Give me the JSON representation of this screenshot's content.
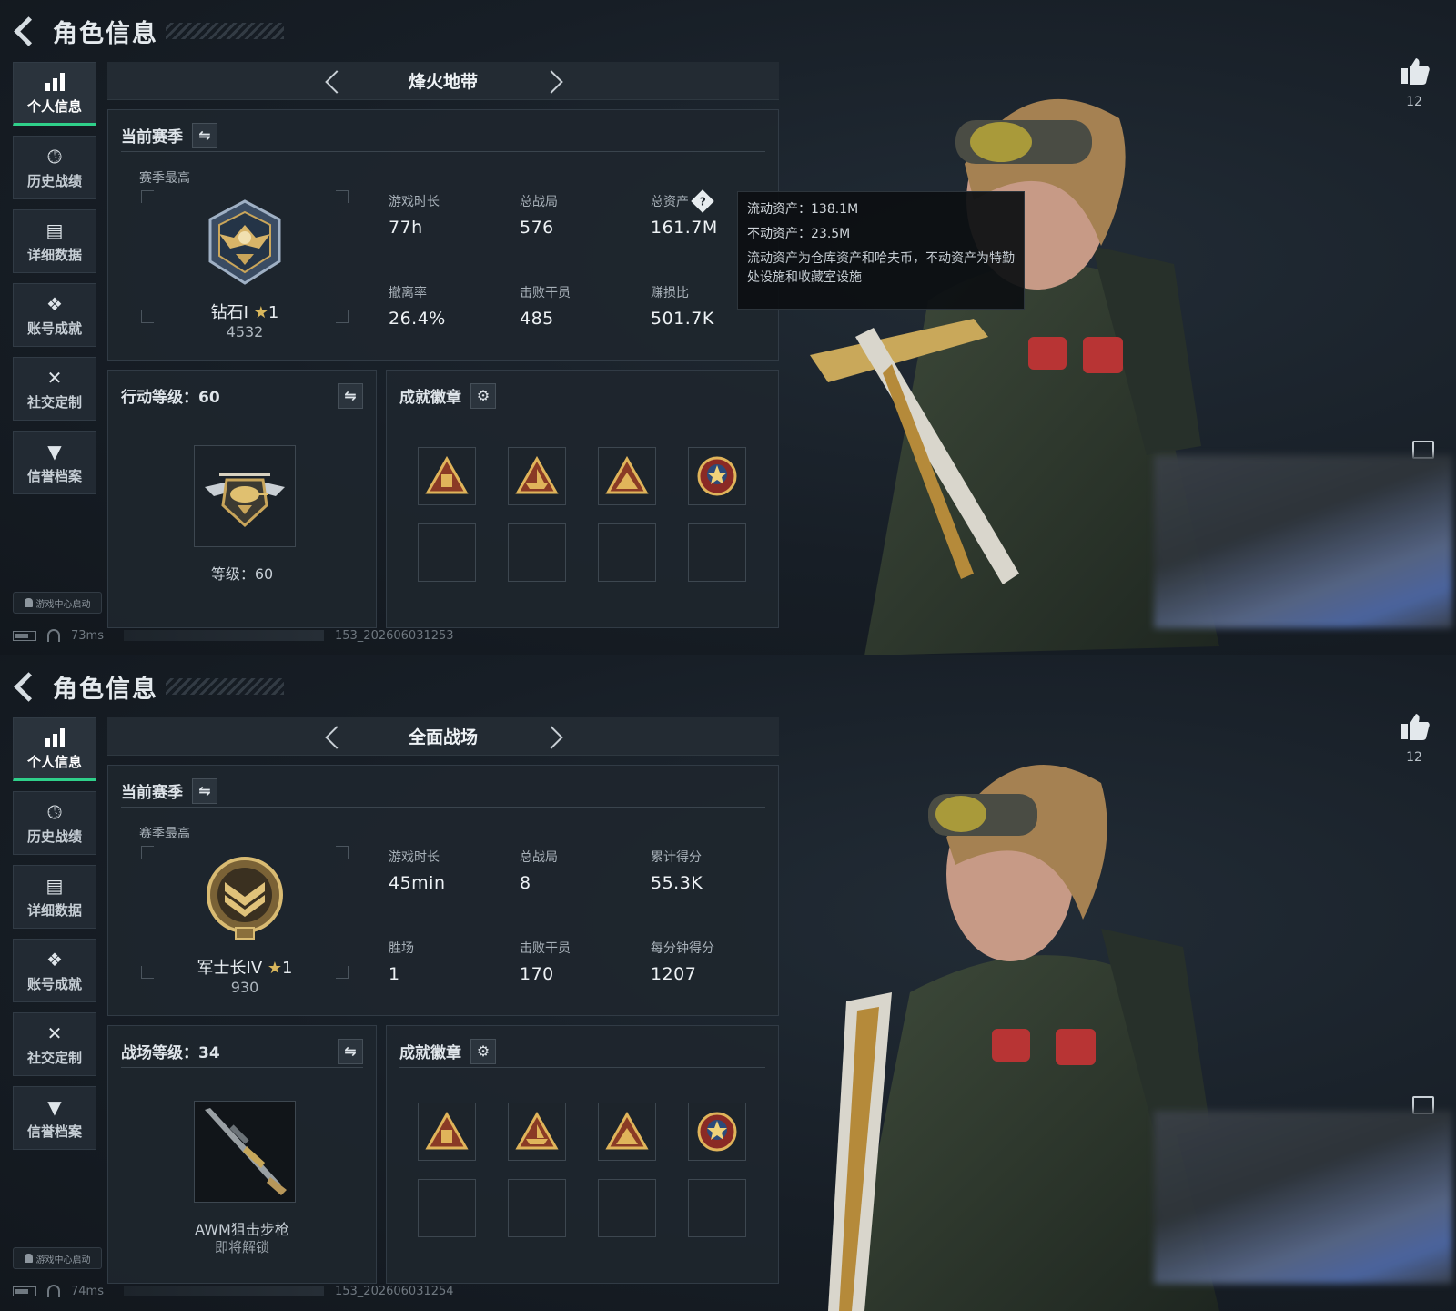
{
  "screens": [
    {
      "header": {
        "title": "角色信息"
      },
      "sidebar": [
        {
          "label": "个人信息",
          "icon": "bar-chart-icon",
          "active": true
        },
        {
          "label": "历史战绩",
          "icon": "clock-icon"
        },
        {
          "label": "详细数据",
          "icon": "folder-icon"
        },
        {
          "label": "账号成就",
          "icon": "achievement-icon"
        },
        {
          "label": "社交定制",
          "icon": "tools-icon"
        },
        {
          "label": "信誉档案",
          "icon": "shield-icon"
        }
      ],
      "launch_label": "游戏中心启动",
      "footer": {
        "ping": "73ms",
        "build": "153_202606031253"
      },
      "mode": "烽火地带",
      "season": {
        "title": "当前赛季",
        "sub": "赛季最高",
        "rank_name": "钻石I",
        "rank_star": "★",
        "rank_stars": "1",
        "rank_score": "4532",
        "stats": [
          {
            "label": "游戏时长",
            "value": "77h"
          },
          {
            "label": "总战局",
            "value": "576"
          },
          {
            "label": "总资产",
            "value": "161.7M",
            "help": "?"
          },
          {
            "label": "撤离率",
            "value": "26.4%"
          },
          {
            "label": "击败干员",
            "value": "485"
          },
          {
            "label": "赚损比",
            "value": "501.7K"
          }
        ]
      },
      "level": {
        "title": "行动等级：60",
        "caption": "等级：60",
        "sub": ""
      },
      "badges": {
        "title": "成就徽章"
      },
      "tooltip": {
        "line1": "流动资产：138.1M",
        "line2": "不动资产：23.5M",
        "note": "流动资产为仓库资产和哈夫币，不动资产为特勤处设施和收藏室设施"
      },
      "likes": "12"
    },
    {
      "header": {
        "title": "角色信息"
      },
      "sidebar": [
        {
          "label": "个人信息",
          "icon": "bar-chart-icon",
          "active": true
        },
        {
          "label": "历史战绩",
          "icon": "clock-icon"
        },
        {
          "label": "详细数据",
          "icon": "folder-icon"
        },
        {
          "label": "账号成就",
          "icon": "achievement-icon"
        },
        {
          "label": "社交定制",
          "icon": "tools-icon"
        },
        {
          "label": "信誉档案",
          "icon": "shield-icon"
        }
      ],
      "launch_label": "游戏中心启动",
      "footer": {
        "ping": "74ms",
        "build": "153_202606031254"
      },
      "mode": "全面战场",
      "season": {
        "title": "当前赛季",
        "sub": "赛季最高",
        "rank_name": "军士长IV",
        "rank_star": "★",
        "rank_stars": "1",
        "rank_score": "930",
        "stats": [
          {
            "label": "游戏时长",
            "value": "45min"
          },
          {
            "label": "总战局",
            "value": "8"
          },
          {
            "label": "累计得分",
            "value": "55.3K"
          },
          {
            "label": "胜场",
            "value": "1"
          },
          {
            "label": "击败干员",
            "value": "170"
          },
          {
            "label": "每分钟得分",
            "value": "1207"
          }
        ]
      },
      "level": {
        "title": "战场等级：34",
        "caption": "AWM狙击步枪",
        "sub": "即将解锁"
      },
      "badges": {
        "title": "成就徽章"
      },
      "likes": "12"
    }
  ],
  "colors": {
    "accent": "#2fd08a",
    "gold": "#d9b75c",
    "background": "#171e26"
  }
}
